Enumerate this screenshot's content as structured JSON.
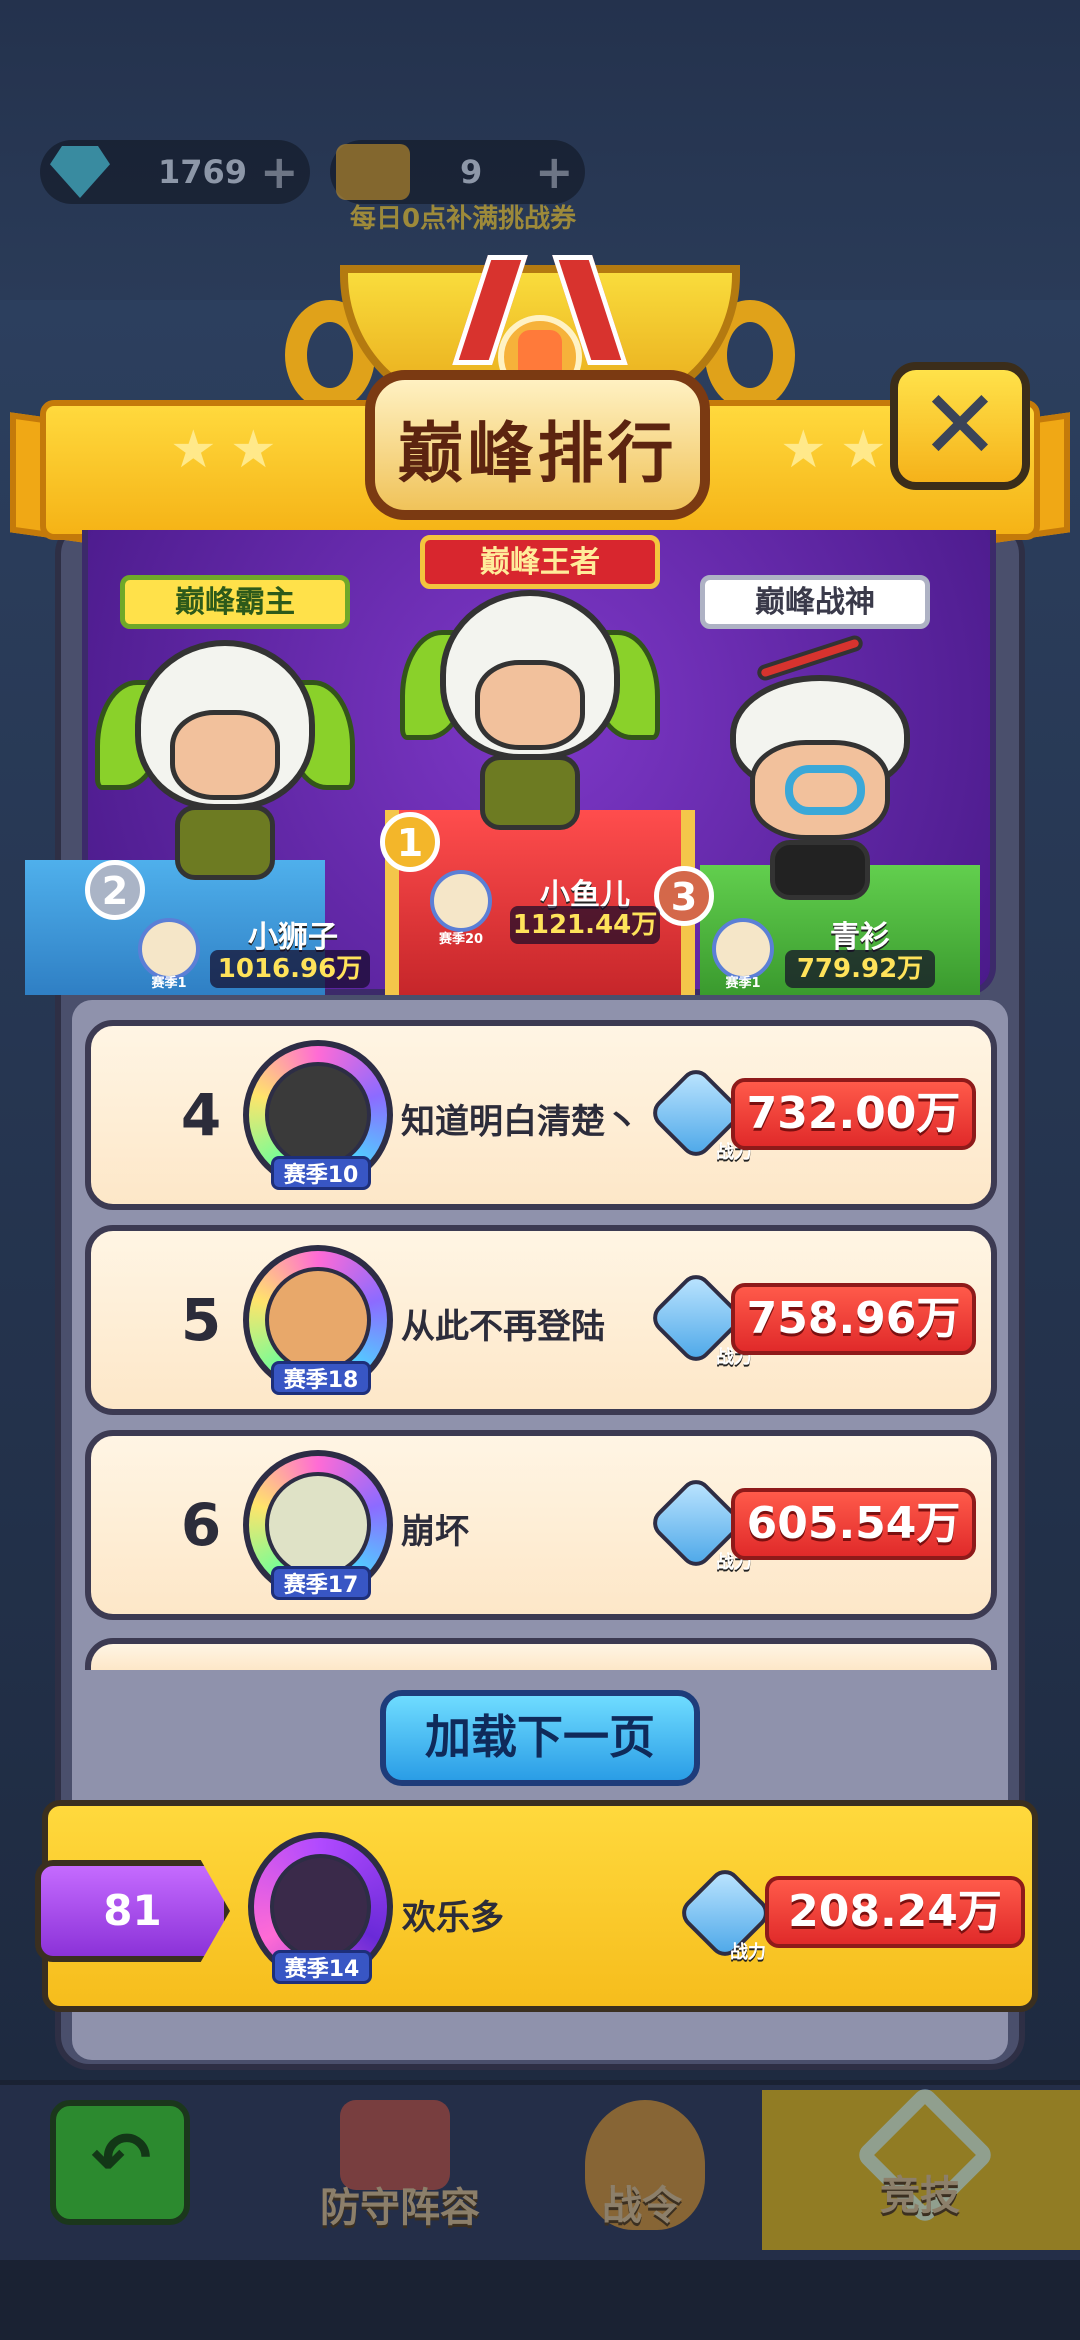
{
  "currency": {
    "diamonds": "1769",
    "tickets": "9",
    "hint": "每日0点补满挑战券"
  },
  "modal": {
    "title": "巅峰排行",
    "close_icon": "close-icon"
  },
  "podium": [
    {
      "place": "1",
      "tag": "巅峰王者",
      "name": "小鱼儿",
      "power": "1121.44万",
      "season": "赛季20"
    },
    {
      "place": "2",
      "tag": "巅峰霸主",
      "name": "小狮子",
      "power": "1016.96万",
      "season": "赛季1"
    },
    {
      "place": "3",
      "tag": "巅峰战神",
      "name": "青衫",
      "power": "779.92万",
      "season": "赛季1"
    }
  ],
  "rows": [
    {
      "rank": "4",
      "name": "知道明白清楚丶",
      "season": "赛季10",
      "power_label": "战力",
      "power": "732.00万"
    },
    {
      "rank": "5",
      "name": "从此不再登陆",
      "season": "赛季18",
      "power_label": "战力",
      "power": "758.96万"
    },
    {
      "rank": "6",
      "name": "崩坏",
      "season": "赛季17",
      "power_label": "战力",
      "power": "605.54万"
    }
  ],
  "load_more": "加载下一页",
  "self": {
    "rank": "81",
    "name": "欢乐多",
    "season": "赛季14",
    "power_label": "战力",
    "power": "208.24万"
  },
  "nav": {
    "defense": "防守阵容",
    "pass": "战令",
    "arena": "竞技"
  },
  "colors": {
    "banner": "#f5b316",
    "power_bar": "#e02a2a",
    "self_rank": "#8b32d8"
  }
}
